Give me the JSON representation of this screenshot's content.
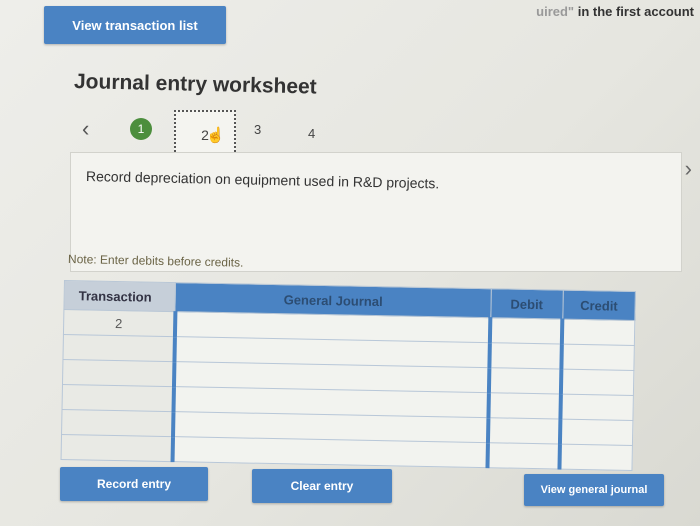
{
  "top_partial": {
    "faded": "uired\"",
    "text": " in the first account"
  },
  "buttons": {
    "view_transaction_list": "View transaction list",
    "record_entry": "Record entry",
    "clear_entry": "Clear entry",
    "view_general_journal": "View general journal"
  },
  "worksheet": {
    "title": "Journal entry worksheet",
    "steps": [
      "1",
      "2",
      "3",
      "4"
    ],
    "current_step": "2",
    "description": "Record depreciation on equipment used in R&D projects.",
    "note": "Note: Enter debits before credits."
  },
  "table": {
    "headers": {
      "transaction": "Transaction",
      "general_journal": "General Journal",
      "debit": "Debit",
      "credit": "Credit"
    },
    "rows": [
      {
        "transaction": "2"
      },
      {
        "transaction": ""
      },
      {
        "transaction": ""
      },
      {
        "transaction": ""
      },
      {
        "transaction": ""
      },
      {
        "transaction": ""
      }
    ]
  },
  "colors": {
    "accent": "#4a83c3",
    "step_done": "#4c8e3d"
  }
}
